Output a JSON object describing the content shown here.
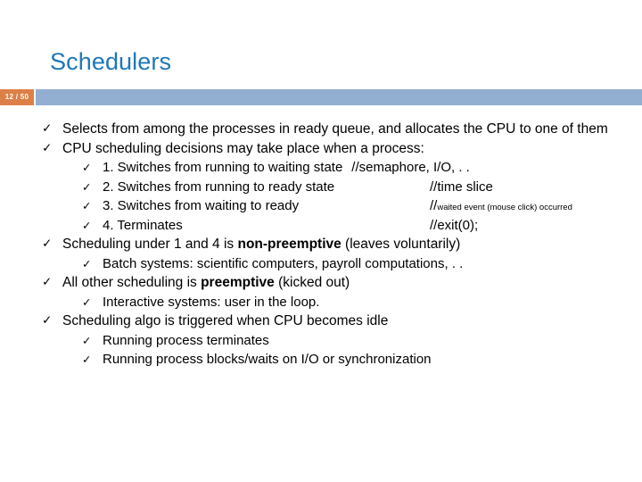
{
  "slide": {
    "title": "Schedulers",
    "page_badge": "12 / 50",
    "title_color": "#1F77B8",
    "bar_color": "#92AED0",
    "badge_color": "#DD8047",
    "bullet_glyph": "✓"
  },
  "content": {
    "b1": "Selects from among the processes in ready queue, and allocates the CPU to one of them",
    "b2": "CPU scheduling decisions may take place when a process:",
    "b2_1_text": "1. Switches from running to waiting state",
    "b2_1_comment": "//semaphore, I/O, . .",
    "b2_2_text": "2. Switches from running to ready state",
    "b2_2_comment": "//time slice",
    "b2_3_text": "3. Switches from waiting to ready",
    "b2_3_comment_slash": "//",
    "b2_3_comment_small": "waited event (mouse click) occurred",
    "b2_4_text": "4. Terminates",
    "b2_4_comment": "//exit(0);",
    "b3_pre": "Scheduling under 1 and 4 is ",
    "b3_bold": "non-preemptive",
    "b3_post": " (leaves voluntarily)",
    "b3_1": "Batch systems: scientific computers, payroll computations, . .",
    "b4_pre": "All other scheduling is ",
    "b4_bold": "preemptive",
    "b4_post": " (kicked out)",
    "b4_1": "Interactive systems: user in the loop.",
    "b5": "Scheduling algo is triggered when CPU becomes idle",
    "b5_1": "Running process terminates",
    "b5_2": "Running process blocks/waits on I/O or synchronization"
  }
}
